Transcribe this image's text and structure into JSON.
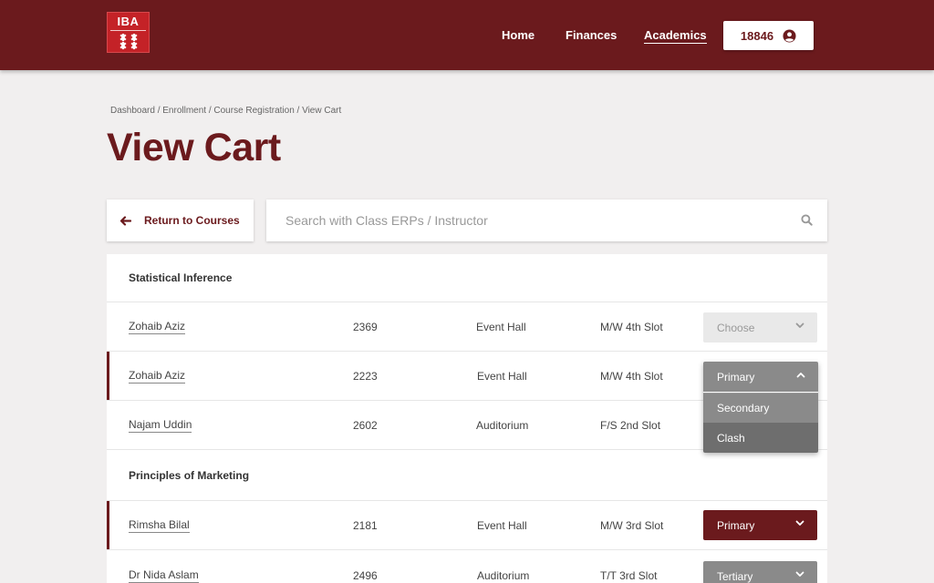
{
  "header": {
    "logo_text": "IBA",
    "nav": [
      {
        "label": "Home"
      },
      {
        "label": "Finances"
      },
      {
        "label": "Academics",
        "active": true
      }
    ],
    "user_id": "18846",
    "colors": {
      "brand": "#6b1a1d",
      "logo_red": "#c42227"
    }
  },
  "breadcrumb": "Dashboard / Enrollment / Course Registration / View Cart",
  "page_title": "View Cart",
  "toolbar": {
    "return_label": "Return to Courses",
    "search_placeholder": "Search with Class ERPs / Instructor"
  },
  "courses": [
    {
      "name": "Statistical Inference",
      "sections": [
        {
          "instructor": "Zohaib Aziz",
          "erp": "2369",
          "venue": "Event Hall",
          "slot": "M/W 4th Slot",
          "priority": "Choose"
        },
        {
          "instructor": "Zohaib Aziz",
          "erp": "2223",
          "venue": "Event Hall",
          "slot": "M/W 4th Slot",
          "priority": "Primary"
        },
        {
          "instructor": "Najam Uddin",
          "erp": "2602",
          "venue": "Auditorium",
          "slot": "F/S  2nd Slot",
          "priority": ""
        }
      ]
    },
    {
      "name": "Principles of Marketing",
      "sections": [
        {
          "instructor": "Rimsha Bilal",
          "erp": "2181",
          "venue": "Event Hall",
          "slot": "M/W 3rd Slot",
          "priority": "Primary"
        },
        {
          "instructor": "Dr Nida Aslam",
          "erp": "2496",
          "venue": "Auditorium",
          "slot": "T/T 3rd Slot",
          "priority": "Tertiary"
        }
      ]
    }
  ],
  "dropdown_options": [
    "Primary",
    "Secondary",
    "Clash"
  ]
}
